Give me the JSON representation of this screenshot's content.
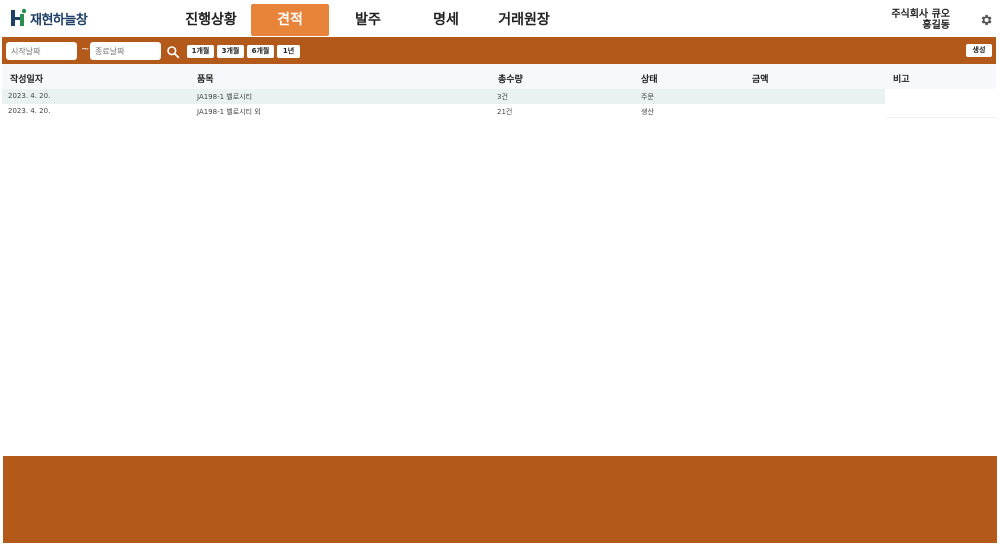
{
  "brand": {
    "name": "재현하늘창"
  },
  "nav": {
    "items": [
      {
        "label": "진행상황",
        "active": false
      },
      {
        "label": "견적",
        "active": true
      },
      {
        "label": "발주",
        "active": false
      },
      {
        "label": "명세",
        "active": false
      },
      {
        "label": "거래원장",
        "active": false
      }
    ]
  },
  "user": {
    "company": "주식회사 큐오",
    "name": "홍길동",
    "settings_icon": "gear-icon"
  },
  "filter": {
    "start_placeholder": "시작날짜",
    "end_placeholder": "종료날짜",
    "separator": "~",
    "search_icon": "search-icon",
    "periods": [
      "1개월",
      "3개월",
      "6개월",
      "1년"
    ],
    "create_label": "생성"
  },
  "table": {
    "columns": [
      "작성일자",
      "품목",
      "총수량",
      "상태",
      "금액",
      "비고"
    ],
    "rows": [
      {
        "date": "2023. 4. 20.",
        "item": "JA198-1 벨로시티",
        "qty": "3건",
        "status": "주문",
        "amount": "",
        "note": ""
      },
      {
        "date": "2023. 4. 20.",
        "item": "JA198-1 벨로시티 외",
        "qty": "21건",
        "status": "생산",
        "amount": "",
        "note": ""
      }
    ]
  },
  "colors": {
    "accent": "#b35a1b",
    "nav_active": "#e8833a",
    "brand_text": "#1e3f66",
    "row_highlight": "#e9f1f3"
  }
}
